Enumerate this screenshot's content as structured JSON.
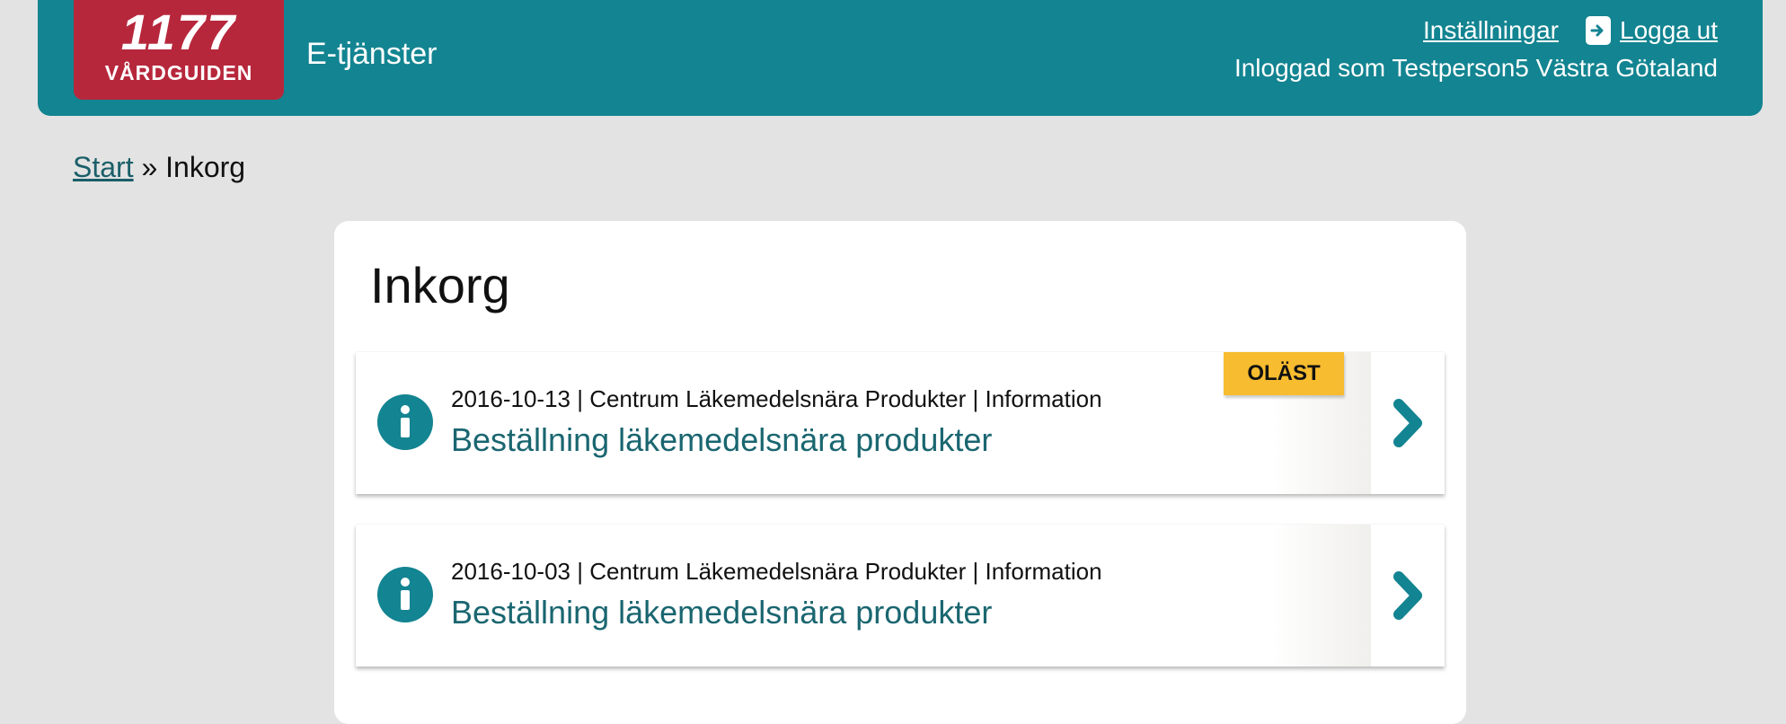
{
  "header": {
    "logo_number": "1177",
    "logo_name": "VÅRDGUIDEN",
    "service_title": "E-tjänster",
    "settings_label": "Inställningar",
    "logout_label": "Logga ut",
    "login_info": "Inloggad som Testperson5 Västra Götaland"
  },
  "breadcrumb": {
    "start_label": "Start",
    "separator": "»",
    "current": "Inkorg"
  },
  "inbox": {
    "title": "Inkorg",
    "messages": [
      {
        "meta": "2016-10-13 | Centrum Läkemedelsnära Produkter | Information",
        "title": "Beställning läkemedelsnära produkter",
        "badge": "OLÄST",
        "icon": "info-icon"
      },
      {
        "meta": "2016-10-03 | Centrum Läkemedelsnära Produkter | Information",
        "title": "Beställning läkemedelsnära produkter",
        "icon": "info-icon"
      }
    ]
  },
  "colors": {
    "header_bg": "#138491",
    "logo_bg": "#b7273c",
    "badge_bg": "#f7bc2f",
    "link_color": "#1a6670",
    "page_bg": "#e3e3e3"
  }
}
